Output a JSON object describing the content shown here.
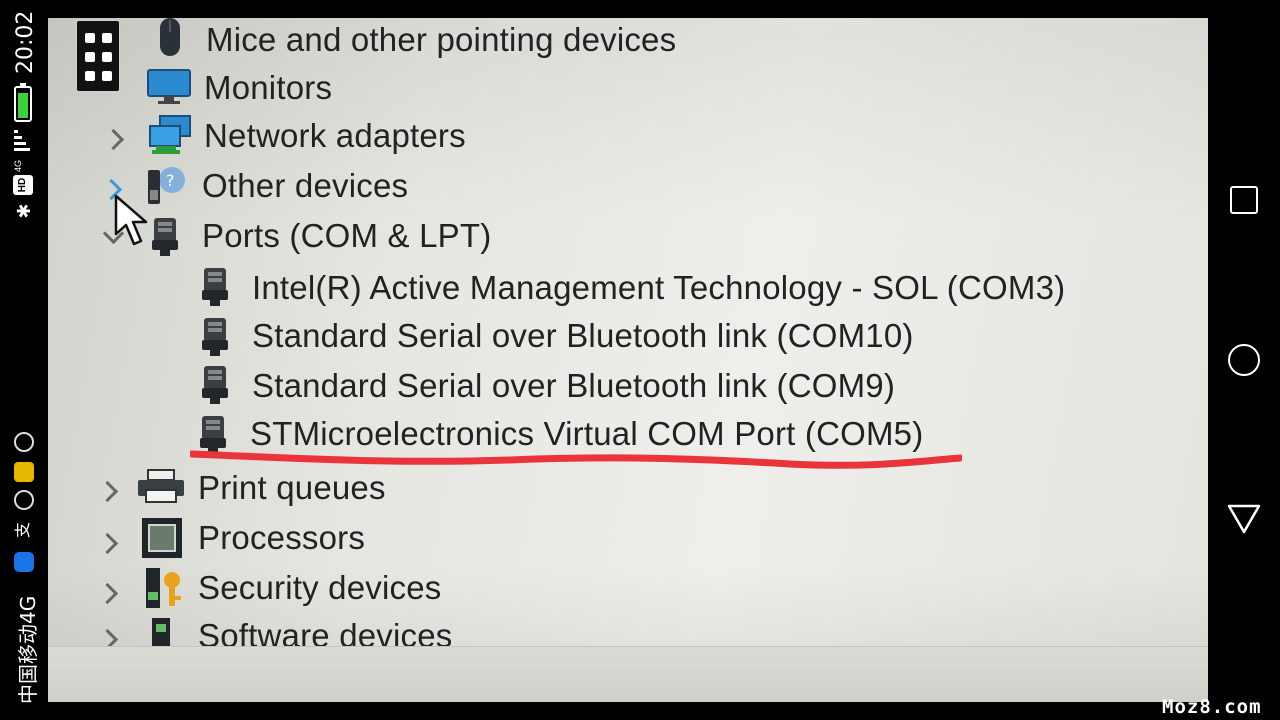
{
  "status_bar": {
    "clock": "20:02",
    "carrier": "中国移动4G",
    "network": "4G",
    "hd_badge": "HD",
    "battery_level": 0.9,
    "icons": [
      "battery-icon",
      "signal-icon",
      "bluetooth-icon",
      "app-notification-icons"
    ]
  },
  "device_manager": {
    "categories": [
      {
        "label": "Mice and other pointing devices",
        "icon": "mouse-icon",
        "expanded": false
      },
      {
        "label": "Monitors",
        "icon": "monitor-icon",
        "expanded": false
      },
      {
        "label": "Network adapters",
        "icon": "network-adapter-icon",
        "expanded": false
      },
      {
        "label": "Other devices",
        "icon": "unknown-device-icon",
        "expanded": false
      },
      {
        "label": "Ports (COM & LPT)",
        "icon": "port-icon",
        "expanded": true
      },
      {
        "label": "Print queues",
        "icon": "printer-icon",
        "expanded": false
      },
      {
        "label": "Processors",
        "icon": "processor-icon",
        "expanded": false
      },
      {
        "label": "Security devices",
        "icon": "security-device-icon",
        "expanded": false
      },
      {
        "label": "Software devices",
        "icon": "software-device-icon",
        "expanded": false
      }
    ],
    "ports": [
      {
        "label": "Intel(R) Active Management Technology - SOL (COM3)"
      },
      {
        "label": "Standard Serial over Bluetooth link (COM10)"
      },
      {
        "label": "Standard Serial over Bluetooth link (COM9)"
      },
      {
        "label": "STMicroelectronics Virtual COM Port (COM5)",
        "highlighted": true
      }
    ]
  },
  "annotation": {
    "underline_color": "#e8343a"
  },
  "nav_bar": {
    "buttons": [
      "recent-apps",
      "home",
      "back"
    ]
  },
  "watermark": "Moz8.com"
}
